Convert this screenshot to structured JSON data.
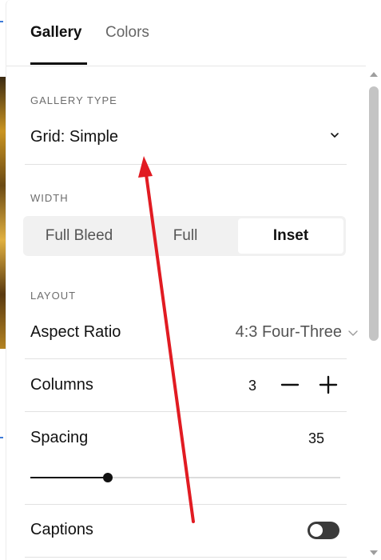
{
  "tabs": [
    {
      "label": "Gallery",
      "active": true
    },
    {
      "label": "Colors",
      "active": false
    }
  ],
  "gallery_type": {
    "section_label": "GALLERY TYPE",
    "selected": "Grid: Simple",
    "icon": "chevron-down-icon"
  },
  "width": {
    "section_label": "WIDTH",
    "options": [
      "Full Bleed",
      "Full",
      "Inset"
    ],
    "selected": "Inset"
  },
  "layout": {
    "section_label": "LAYOUT",
    "aspect_ratio": {
      "label": "Aspect Ratio",
      "value": "4:3 Four-Three"
    },
    "columns": {
      "label": "Columns",
      "value": "3"
    },
    "spacing": {
      "label": "Spacing",
      "value": "35",
      "slider_fraction": 0.25
    }
  },
  "captions": {
    "label": "Captions",
    "enabled": false
  },
  "annotation": {
    "type": "red-arrow",
    "color": "#e11b22"
  },
  "colors": {
    "accent": "#111111",
    "arrow": "#e11b22",
    "toggle_off": "#3a3a3a"
  }
}
